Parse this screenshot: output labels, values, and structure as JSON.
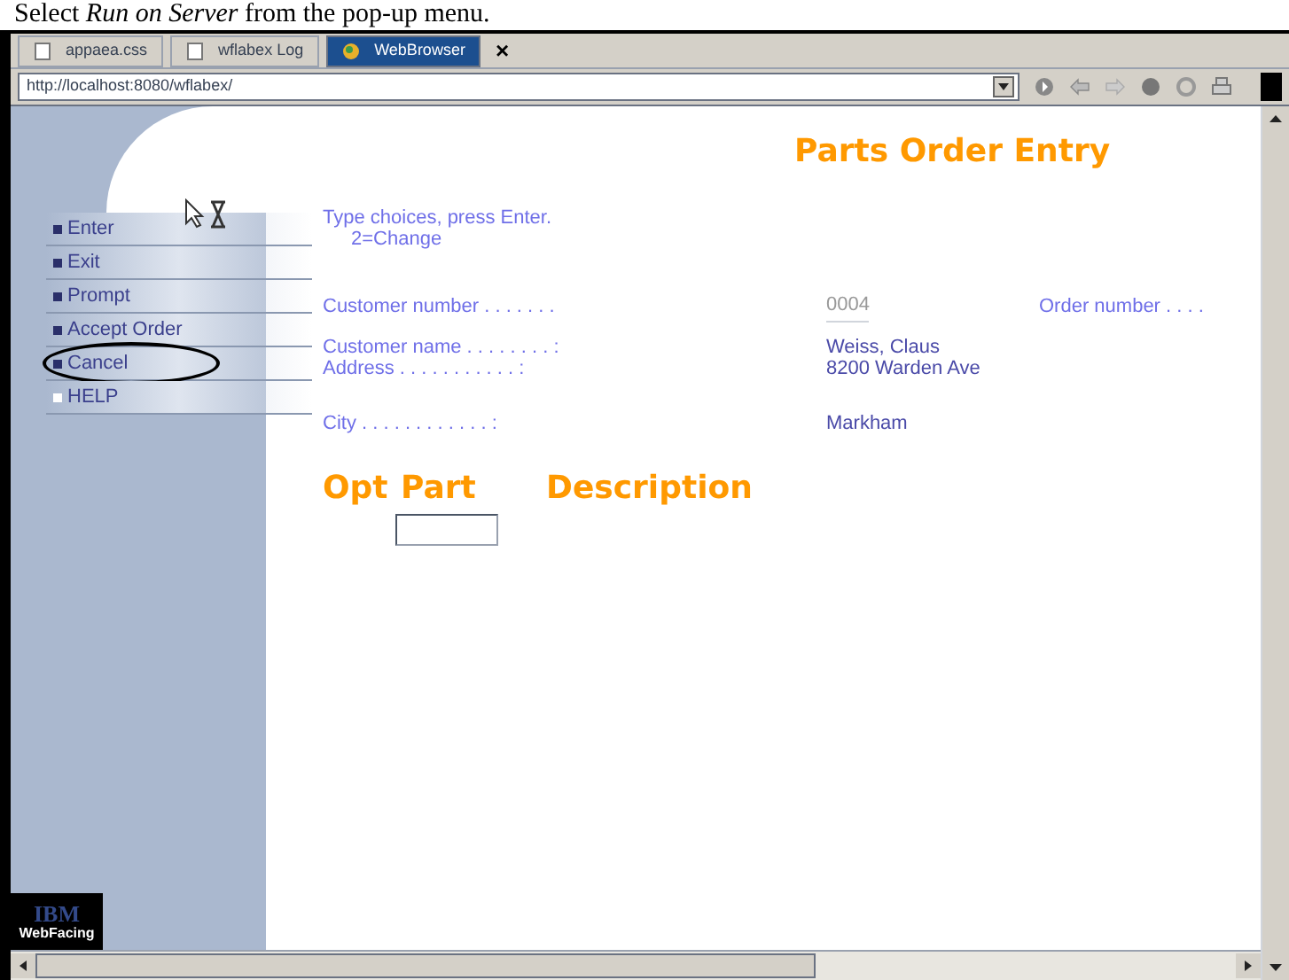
{
  "caption": "Select *Run on Server* from the pop-up menu.",
  "tabs": [
    {
      "label": "appaea.css",
      "selected": false
    },
    {
      "label": "wflabex Log",
      "selected": false
    },
    {
      "label": "WebBrowser",
      "selected": true
    }
  ],
  "tab_close": "×",
  "address": "http://localhost:8080/wflabex/",
  "page": {
    "title": "Parts Order Entry",
    "menu": [
      {
        "label": "Enter",
        "kind": "command",
        "circled": false
      },
      {
        "label": "Exit",
        "kind": "command",
        "circled": false
      },
      {
        "label": "Prompt",
        "kind": "command",
        "circled": false
      },
      {
        "label": "Accept Order",
        "kind": "command",
        "circled": false
      },
      {
        "label": "Cancel",
        "kind": "command",
        "circled": true
      },
      {
        "label": "HELP",
        "kind": "help",
        "circled": false
      }
    ],
    "instructions": [
      "Type choices, press Enter.",
      "2=Change"
    ],
    "customer_number_label": "Customer number . . . . . . .",
    "customer_number": "0004",
    "order_number_label": "Order number . . . .",
    "customer_name_label": "Customer name . . . . . . . . :",
    "customer_name": "Weiss, Claus",
    "address_label": "Address . . . . . . . . . . . :",
    "address": "8200 Warden Ave",
    "city_label": "City . . . . . . . . . . . . :",
    "city": "Markham",
    "columns": [
      "Opt",
      "Part",
      "Description"
    ],
    "logo": {
      "brand": "IBM",
      "product": "WebFacing"
    }
  }
}
